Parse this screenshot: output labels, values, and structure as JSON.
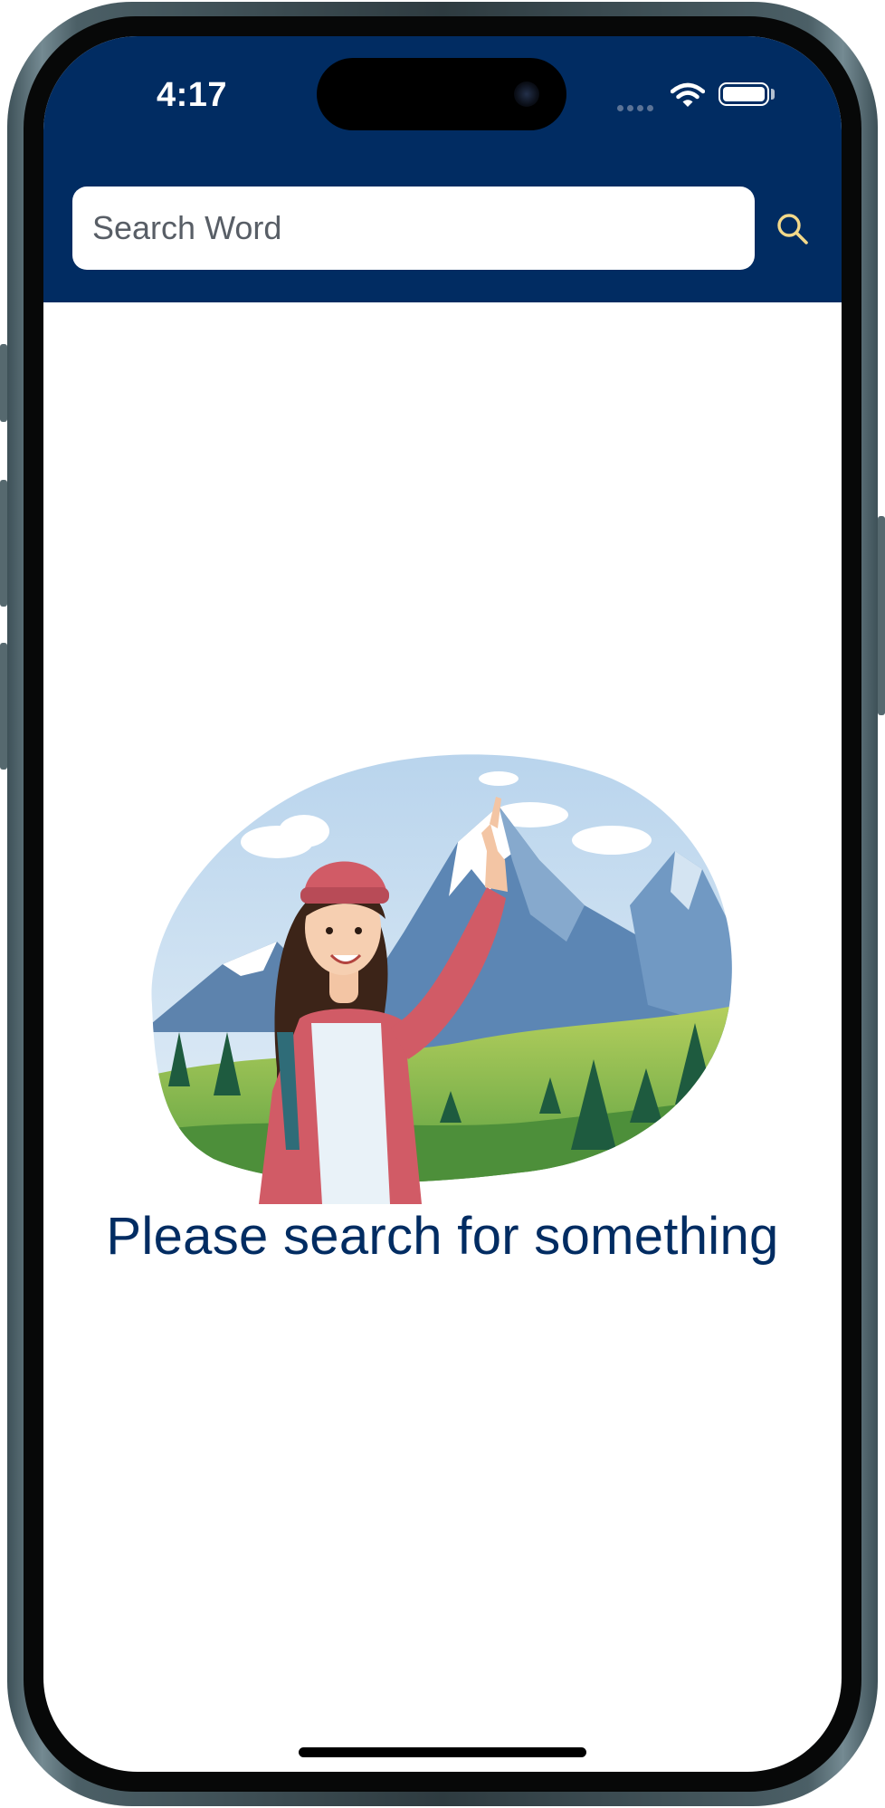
{
  "status_bar": {
    "time": "4:17"
  },
  "search": {
    "placeholder": "Search Word",
    "value": "",
    "button_icon": "search-icon"
  },
  "empty_state": {
    "message": "Please search for something",
    "illustration": "hiker-woman-pointing-at-mountains"
  },
  "colors": {
    "primary": "#012c62",
    "search_icon": "#f3d98a",
    "background": "#ffffff"
  }
}
